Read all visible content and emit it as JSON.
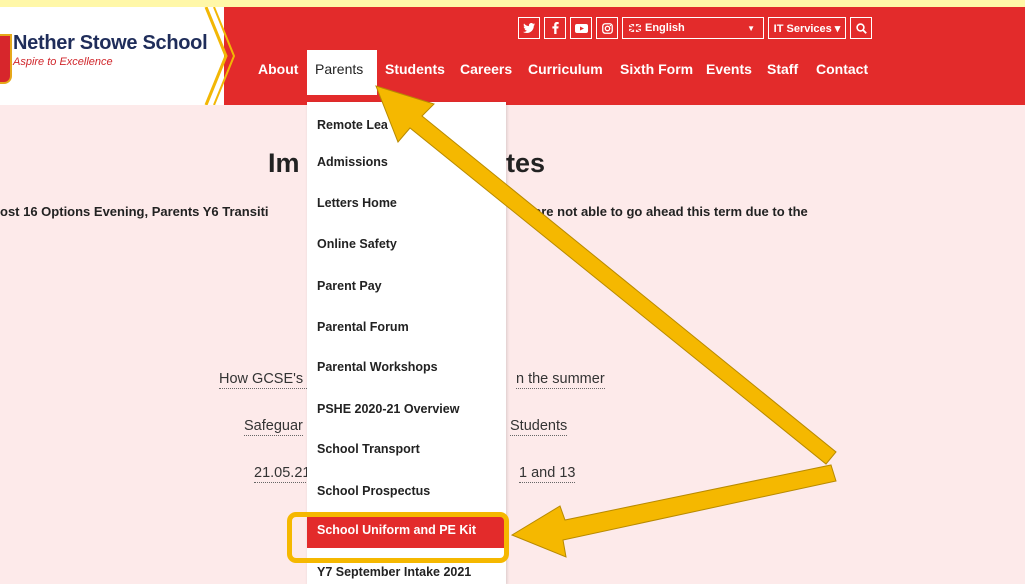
{
  "school": {
    "name": "Nether Stowe School",
    "motto": "Aspire to Excellence"
  },
  "utility": {
    "language": "English",
    "language_flag": "uk-flag-icon",
    "it_services": "IT Services ▾",
    "social_icons": [
      "twitter-icon",
      "facebook-icon",
      "youtube-icon",
      "instagram-icon"
    ]
  },
  "nav": {
    "items": [
      "About",
      "Parents",
      "Students",
      "Careers",
      "Curriculum",
      "Sixth Form",
      "Events",
      "Staff",
      "Contact"
    ],
    "active": "Parents"
  },
  "page": {
    "title_left": "Im",
    "title_right": "tes",
    "intro_left": "ost 16 Options Evening, Parents Y6 Transiti",
    "intro_right": "are not able to go ahead this term due to the",
    "links": [
      {
        "left": "How GCSE's a",
        "right": "n the summer"
      },
      {
        "left": "Safeguar",
        "right": "Students"
      },
      {
        "left": "21.05.21",
        "right": "1 and 13"
      }
    ]
  },
  "dropdown": {
    "items": [
      "Remote Lea",
      "Admissions",
      "Letters Home",
      "Online Safety",
      "Parent Pay",
      "Parental Forum",
      "Parental Workshops",
      "PSHE 2020-21 Overview",
      "School Transport",
      "School Prospectus",
      "School Uniform and PE Kit",
      "Y7 September Intake 2021"
    ],
    "highlighted": "School Uniform and PE Kit"
  },
  "colors": {
    "brand_red": "#e32b2b",
    "navy": "#1f2d5a",
    "annotation_yellow": "#f5b800",
    "page_bg": "#fdeaea"
  }
}
